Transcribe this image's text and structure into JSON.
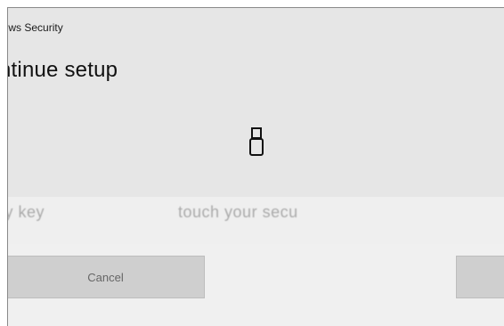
{
  "window": {
    "title": "dows Security"
  },
  "content": {
    "heading": "ntinue setup",
    "usb_icon": "usb-security-key-icon",
    "message_left": "rity key",
    "message_right": "touch your secu"
  },
  "buttons": {
    "cancel_label": "Cancel",
    "ok_label": ""
  },
  "colors": {
    "dialog_background": "#e6e6e6",
    "button_background": "#cfcfcf"
  }
}
